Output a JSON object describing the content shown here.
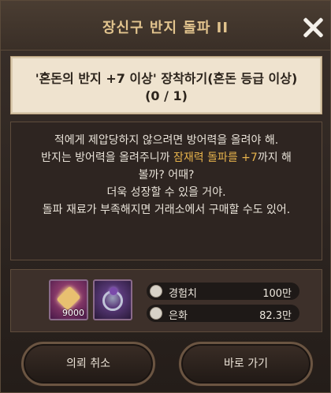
{
  "dialog": {
    "title": "장신구 반지 돌파 II"
  },
  "quest": {
    "line1": "'혼돈의 반지 +7 이상' 장착하기(혼돈 등급 이상)",
    "line2": "(0 / 1)"
  },
  "npc_text": {
    "line1": "적에게 제압당하지 않으려면 방어력을 올려야 해.",
    "line2_prefix": "반지는 방어력을 올려주니까 ",
    "line2_highlight": "잠재력 돌파를 +7",
    "line2_suffix": "까지 해",
    "line3": "볼까? 어때?",
    "line4": "더욱 성장할 수 있을 거야.",
    "line5": "돌파 재료가 부족해지면 거래소에서 구매할 수도 있어.",
    "highlight_color": "#e7b34c"
  },
  "rewards": {
    "items": [
      {
        "icon": "gold-gem-icon",
        "quantity": "9000"
      },
      {
        "icon": "purple-ring-icon",
        "quantity": ""
      }
    ],
    "stats": [
      {
        "icon": "exp-coin-icon",
        "label": "경험치",
        "value": "100만"
      },
      {
        "icon": "silver-coin-icon",
        "label": "은화",
        "value": "82.3만"
      }
    ]
  },
  "buttons": {
    "cancel_label": "의뢰 취소",
    "go_label": "바로 가기"
  }
}
